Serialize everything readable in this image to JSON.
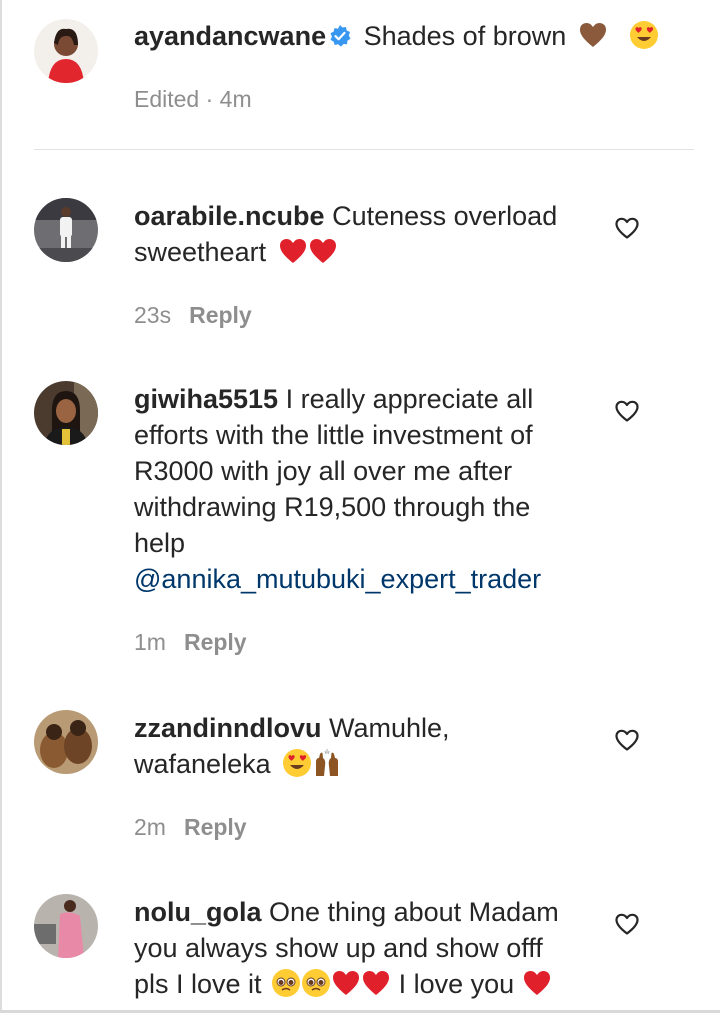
{
  "caption": {
    "username": "ayandancwane",
    "text": "Shades of brown",
    "meta": "Edited · 4m"
  },
  "comments": [
    {
      "username": "oarabile.ncube",
      "text_line1": "Cuteness overload",
      "text_line2": "sweetheart",
      "time": "23s",
      "reply": "Reply"
    },
    {
      "username": "giwiha5515",
      "text_line1": "I really appreciate all",
      "text_line2": "efforts with the little investment of",
      "text_line3": "R3000 with joy all over me after",
      "text_line4": "withdrawing R19,500 through the",
      "text_line5": "help",
      "mention": "@annika_mutubuki_expert_trader",
      "time": "1m",
      "reply": "Reply"
    },
    {
      "username": "zzandinndlovu",
      "text_line1": "Wamuhle,",
      "text_line2": "wafaneleka",
      "time": "2m",
      "reply": "Reply"
    },
    {
      "username": "nolu_gola",
      "text_line1": "One thing about Madam",
      "text_line2": "you always show up and show offf",
      "text_line3": "pls I love it",
      "text_line3b": "I love you"
    }
  ],
  "icons": {
    "like": "heart-outline-icon",
    "verified": "verified-badge-icon",
    "accent": "#3897f0",
    "mention_color": "#00376b",
    "heart_red": "#e0202a",
    "brown_heart": "#8b5a3c"
  }
}
